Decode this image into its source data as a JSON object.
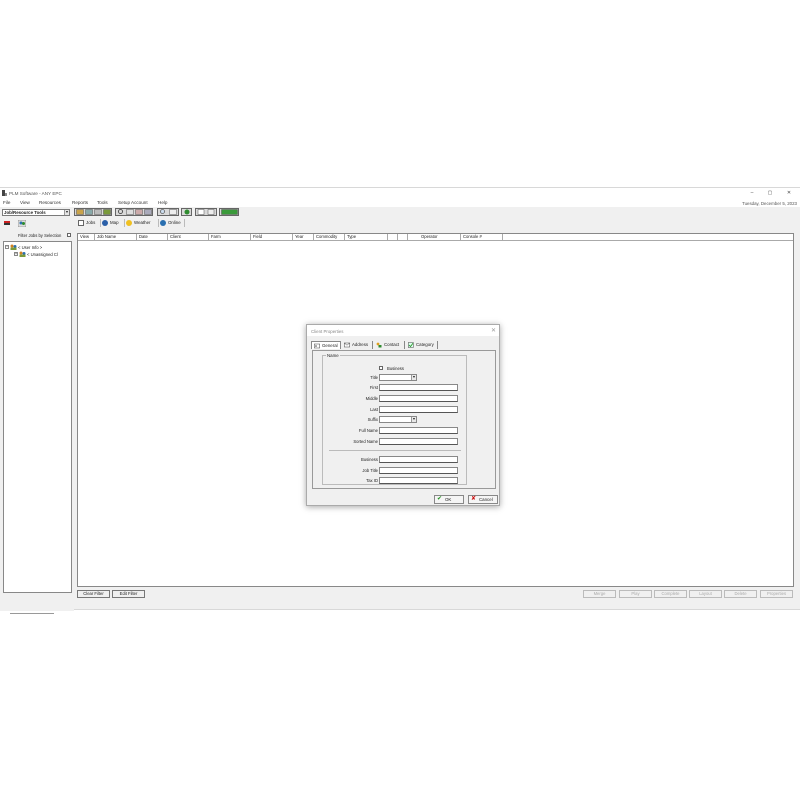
{
  "window": {
    "title": "PLM Software - ANY EPC",
    "minimize": "–",
    "maximize": "▢",
    "close": "✕"
  },
  "menu": [
    "File",
    "View",
    "Resources",
    "Reports",
    "Tools",
    "Setup Account",
    "Help"
  ],
  "datetime": "Tuesday, December 5, 2023",
  "left_panel": {
    "tool_select": "Job/Resource Tools",
    "filter_label": "Filter Jobs by Selection",
    "tree": [
      {
        "expander": "−",
        "label": "< User Info >"
      },
      {
        "expander": "+",
        "label": "< Unassigned Cl"
      }
    ]
  },
  "tabs": [
    "Jobs",
    "Map",
    "Weather",
    "Online"
  ],
  "grid": {
    "columns": [
      "View",
      "Job Name",
      "Date",
      "Client",
      "Farm",
      "Field",
      "Year",
      "Commodity",
      "Type",
      "",
      "",
      "Operator",
      "Console #"
    ]
  },
  "bottom_buttons": {
    "clear_filter": "Clear Filter",
    "edit_filter": "Edit Filter",
    "merge": "Merge",
    "play": "Play",
    "complete": "Complete",
    "layout": "Layout",
    "delete": "Delete",
    "properties": "Properties"
  },
  "watermark": "RE",
  "dialog": {
    "title": "Client Properties",
    "close": "✕",
    "tabs": [
      "General",
      "Address",
      "Contact",
      "Category"
    ],
    "group_label": "Name",
    "business_checkbox": "Business",
    "fields": {
      "title": "Title",
      "first": "First",
      "middle": "Middle",
      "last": "Last",
      "suffix": "Suffix",
      "full_name": "Full Name",
      "sorted_name": "Sorted Name",
      "business": "Business",
      "job_title": "Job Title",
      "tax_id": "Tax ID"
    },
    "ok": "OK",
    "cancel": "Cancel"
  },
  "colors": {
    "accent_green": "#2e8b2e",
    "ok_check": "#1f8f1f",
    "cancel_x": "#cc1111"
  }
}
